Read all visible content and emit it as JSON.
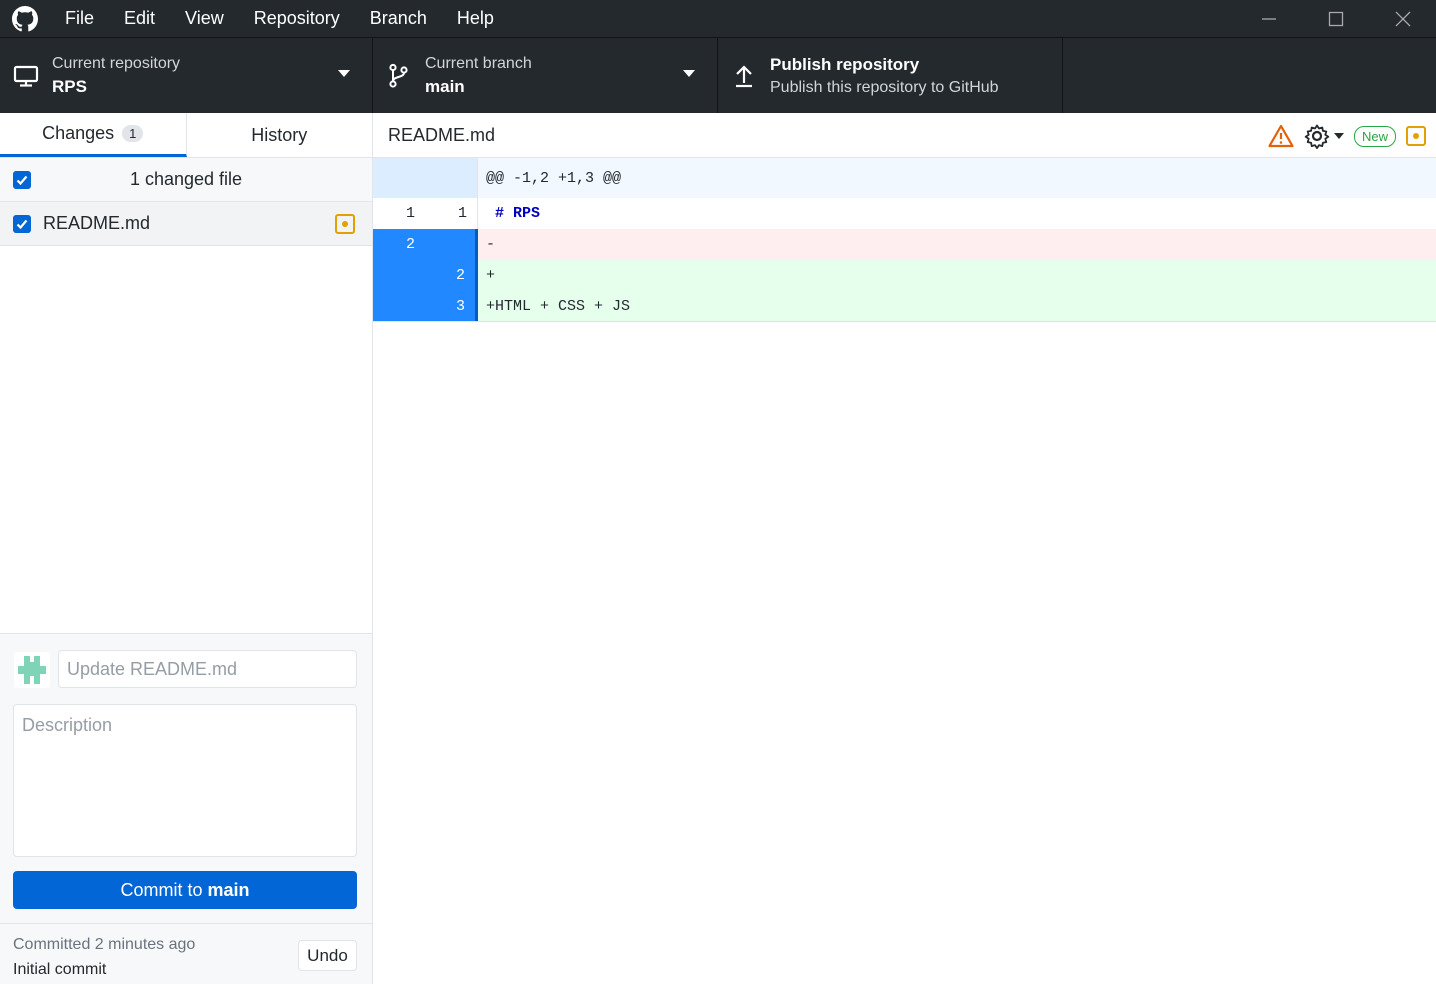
{
  "menu": [
    "File",
    "Edit",
    "View",
    "Repository",
    "Branch",
    "Help"
  ],
  "toolbar": {
    "repo_label": "Current repository",
    "repo_value": "RPS",
    "branch_label": "Current branch",
    "branch_value": "main",
    "publish_label": "Publish repository",
    "publish_desc": "Publish this repository to GitHub"
  },
  "tabs": {
    "changes": "Changes",
    "changes_count": "1",
    "history": "History"
  },
  "changes": {
    "header": "1 changed file",
    "files": [
      {
        "name": "README.md",
        "status": "modified"
      }
    ]
  },
  "commit": {
    "summary_placeholder": "Update README.md",
    "description_placeholder": "Description",
    "button_prefix": "Commit to",
    "button_branch": "main"
  },
  "undo": {
    "line1": "Committed 2 minutes ago",
    "line2": "Initial commit",
    "button": "Undo"
  },
  "diff": {
    "filename": "README.md",
    "new_badge": "New",
    "hunk": "@@ -1,2 +1,3 @@",
    "lines": [
      {
        "old": "1",
        "new": "1",
        "text": " # RPS",
        "type": "context"
      },
      {
        "old": "2",
        "new": "",
        "text": "-",
        "type": "del"
      },
      {
        "old": "",
        "new": "2",
        "text": "+",
        "type": "add"
      },
      {
        "old": "",
        "new": "3",
        "text": "+HTML + CSS + JS",
        "type": "add"
      }
    ]
  },
  "colors": {
    "accent": "#0366d6",
    "titlebar": "#24292e",
    "modified": "#e2a100",
    "added_bg": "#e6ffed",
    "deleted_bg": "#ffeef0"
  }
}
